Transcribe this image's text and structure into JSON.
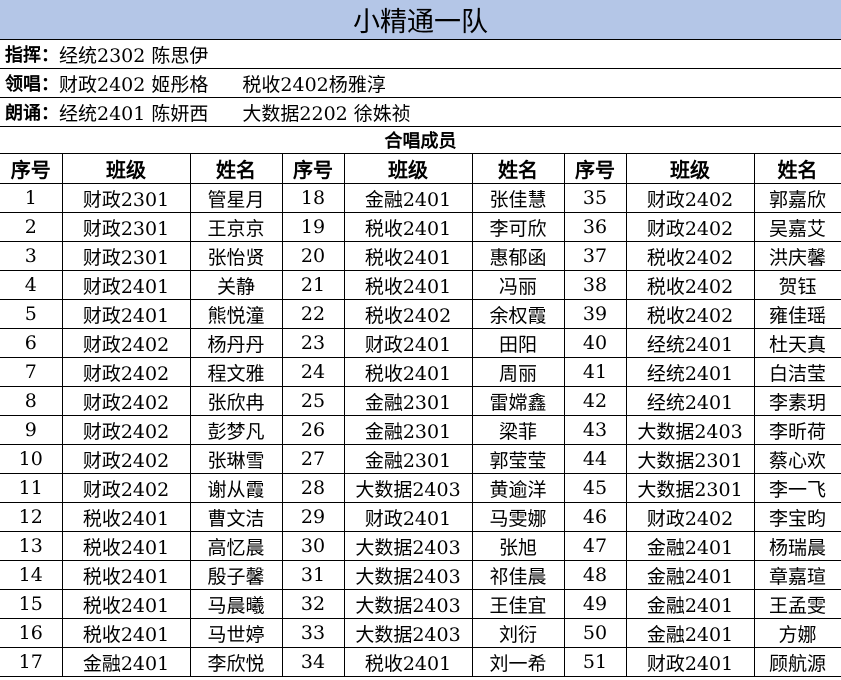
{
  "title": "小精通一队",
  "conductor": {
    "label": "指挥：",
    "value": "经统2302 陈思伊"
  },
  "lead_singers": {
    "label": "领唱：",
    "value1": "财政2402 姬彤格",
    "value2": "税收2402杨雅淳"
  },
  "reciters": {
    "label": "朗诵：",
    "value1": "经统2401 陈妍西",
    "value2": "大数据2202 徐姝祯"
  },
  "members_heading": "合唱成员",
  "table": {
    "headers": [
      "序号",
      "班级",
      "姓名",
      "序号",
      "班级",
      "姓名",
      "序号",
      "班级",
      "姓名"
    ],
    "rows": [
      [
        "1",
        "财政2301",
        "管星月",
        "18",
        "金融2401",
        "张佳慧",
        "35",
        "财政2402",
        "郭嘉欣"
      ],
      [
        "2",
        "财政2301",
        "王京京",
        "19",
        "税收2401",
        "李可欣",
        "36",
        "财政2402",
        "吴嘉艾"
      ],
      [
        "3",
        "财政2301",
        "张怡贤",
        "20",
        "税收2401",
        "惠郁函",
        "37",
        "税收2402",
        "洪庆馨"
      ],
      [
        "4",
        "财政2401",
        "关静",
        "21",
        "税收2401",
        "冯丽",
        "38",
        "税收2402",
        "贺钰"
      ],
      [
        "5",
        "财政2401",
        "熊悦潼",
        "22",
        "税收2402",
        "余权霞",
        "39",
        "税收2402",
        "雍佳瑶"
      ],
      [
        "6",
        "财政2402",
        "杨丹丹",
        "23",
        "财政2401",
        "田阳",
        "40",
        "经统2401",
        "杜天真"
      ],
      [
        "7",
        "财政2402",
        "程文雅",
        "24",
        "税收2401",
        "周丽",
        "41",
        "经统2401",
        "白洁莹"
      ],
      [
        "8",
        "财政2402",
        "张欣冉",
        "25",
        "金融2301",
        "雷嫦鑫",
        "42",
        "经统2401",
        "李素玥"
      ],
      [
        "9",
        "财政2402",
        "彭梦凡",
        "26",
        "金融2301",
        "梁菲",
        "43",
        "大数据2403",
        "李昕荷"
      ],
      [
        "10",
        "财政2402",
        "张琳雪",
        "27",
        "金融2301",
        "郭莹莹",
        "44",
        "大数据2301",
        "蔡心欢"
      ],
      [
        "11",
        "财政2402",
        "谢从霞",
        "28",
        "大数据2403",
        "黄逾洋",
        "45",
        "大数据2301",
        "李一飞"
      ],
      [
        "12",
        "税收2401",
        "曹文洁",
        "29",
        "财政2401",
        "马雯娜",
        "46",
        "财政2402",
        "李宝昀"
      ],
      [
        "13",
        "税收2401",
        "高忆晨",
        "30",
        "大数据2403",
        "张旭",
        "47",
        "金融2401",
        "杨瑞晨"
      ],
      [
        "14",
        "税收2401",
        "殷子馨",
        "31",
        "大数据2403",
        "祁佳晨",
        "48",
        "金融2401",
        "章嘉瑄"
      ],
      [
        "15",
        "税收2401",
        "马晨曦",
        "32",
        "大数据2403",
        "王佳宜",
        "49",
        "金融2401",
        "王孟雯"
      ],
      [
        "16",
        "税收2401",
        "马世婷",
        "33",
        "大数据2403",
        "刘衍",
        "50",
        "金融2401",
        "方娜"
      ],
      [
        "17",
        "金融2401",
        "李欣悦",
        "34",
        "税收2401",
        "刘一希",
        "51",
        "财政2401",
        "顾航源"
      ]
    ]
  }
}
